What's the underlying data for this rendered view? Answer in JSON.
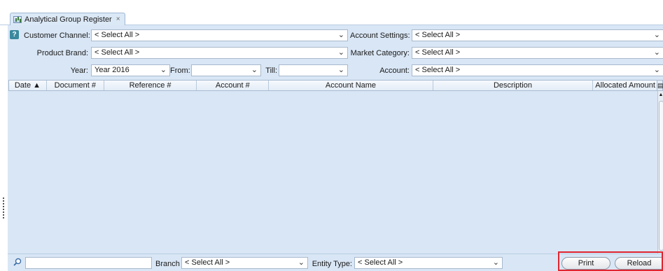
{
  "tab": {
    "title": "Analytical Group Register",
    "close": "×"
  },
  "help_glyph": "?",
  "filters": {
    "customer_channel": {
      "label": "Customer Channel:",
      "value": "< Select All >"
    },
    "account_settings": {
      "label": "Account Settings:",
      "value": "< Select All >"
    },
    "product_brand": {
      "label": "Product Brand:",
      "value": "< Select All >"
    },
    "market_category": {
      "label": "Market Category:",
      "value": "< Select All >"
    },
    "year": {
      "label": "Year:",
      "value": "Year 2016"
    },
    "from": {
      "label": "From:",
      "value": ""
    },
    "till": {
      "label": "Till:",
      "value": ""
    },
    "account": {
      "label": "Account:",
      "value": "< Select All >"
    }
  },
  "grid": {
    "columns": [
      "Date ▲",
      "Document #",
      "Reference #",
      "Account #",
      "Account Name",
      "Description",
      "Allocated Amount"
    ],
    "rows": []
  },
  "bottom": {
    "search_value": "",
    "branch": {
      "label": "Branch",
      "value": "< Select All >"
    },
    "entity_type": {
      "label": "Entity Type:",
      "value": "< Select All >"
    }
  },
  "buttons": {
    "print": "Print",
    "reload": "Reload"
  },
  "icons": {
    "dropdown": "chevron-down-icon",
    "search": "search-icon",
    "help": "help-icon",
    "tab": "chart-icon"
  }
}
